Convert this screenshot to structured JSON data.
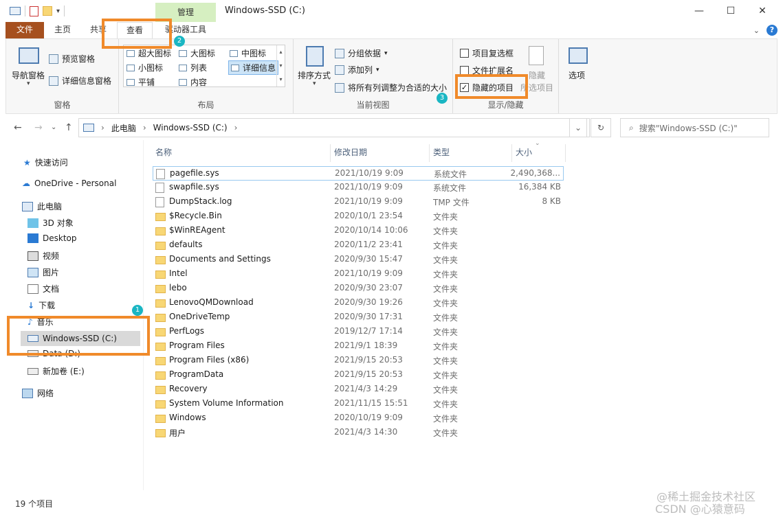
{
  "window": {
    "title": "Windows-SSD (C:)",
    "context_tab": "管理",
    "controls": {
      "minimize": "—",
      "maximize": "☐",
      "close": "✕"
    }
  },
  "ribbon_tabs": {
    "file": "文件",
    "home": "主页",
    "share": "共享",
    "view": "查看",
    "drive_tools": "驱动器工具",
    "collapse": "⌄",
    "help": "?"
  },
  "ribbon": {
    "panes": {
      "label": "窗格",
      "nav_pane": "导航窗格",
      "preview_pane": "预览窗格",
      "details_pane": "详细信息窗格"
    },
    "layout": {
      "label": "布局",
      "items": [
        "超大图标",
        "大图标",
        "中图标",
        "小图标",
        "列表",
        "详细信息",
        "平铺",
        "内容"
      ],
      "selected": "详细信息"
    },
    "current_view": {
      "label": "当前视图",
      "sort_by": "排序方式",
      "group_by": "分组依据",
      "add_columns": "添加列",
      "fit_columns": "将所有列调整为合适的大小"
    },
    "show_hide": {
      "label": "显示/隐藏",
      "item_checkboxes": {
        "label": "项目复选框",
        "checked": false
      },
      "file_extensions": {
        "label": "文件扩展名",
        "checked": false
      },
      "hidden_items": {
        "label": "隐藏的项目",
        "checked": true
      },
      "hide_selected": "隐藏",
      "hide_selected_2": "所选项目"
    },
    "options": "选项"
  },
  "badges": {
    "one": "1",
    "two": "2",
    "three": "3"
  },
  "nav": {
    "back": "←",
    "forward": "→",
    "recent": "⌄",
    "up": "↑",
    "breadcrumb": [
      "此电脑",
      "Windows-SSD (C:)"
    ],
    "search_placeholder": "搜索\"Windows-SSD (C:)\""
  },
  "sidebar": {
    "quick_access": "快速访问",
    "onedrive": "OneDrive - Personal",
    "this_pc": "此电脑",
    "items": [
      "3D 对象",
      "Desktop",
      "视频",
      "图片",
      "文档",
      "下载",
      "音乐",
      "Windows-SSD (C:)",
      "Data (D:)",
      "新加卷 (E:)"
    ],
    "network": "网络"
  },
  "columns": {
    "name": "名称",
    "date": "修改日期",
    "type": "类型",
    "size": "大小"
  },
  "files": [
    {
      "name": "pagefile.sys",
      "date": "2021/10/19 9:09",
      "type": "系统文件",
      "size": "2,490,368...",
      "kind": "file"
    },
    {
      "name": "swapfile.sys",
      "date": "2021/10/19 9:09",
      "type": "系统文件",
      "size": "16,384 KB",
      "kind": "file"
    },
    {
      "name": "DumpStack.log",
      "date": "2021/10/19 9:09",
      "type": "TMP 文件",
      "size": "8 KB",
      "kind": "file"
    },
    {
      "name": "$Recycle.Bin",
      "date": "2020/10/1 23:54",
      "type": "文件夹",
      "size": "",
      "kind": "folder"
    },
    {
      "name": "$WinREAgent",
      "date": "2020/10/14 10:06",
      "type": "文件夹",
      "size": "",
      "kind": "folder"
    },
    {
      "name": "defaults",
      "date": "2020/11/2 23:41",
      "type": "文件夹",
      "size": "",
      "kind": "folder"
    },
    {
      "name": "Documents and Settings",
      "date": "2020/9/30 15:47",
      "type": "文件夹",
      "size": "",
      "kind": "folder"
    },
    {
      "name": "Intel",
      "date": "2021/10/19 9:09",
      "type": "文件夹",
      "size": "",
      "kind": "folder"
    },
    {
      "name": "lebo",
      "date": "2020/9/30 23:07",
      "type": "文件夹",
      "size": "",
      "kind": "folder"
    },
    {
      "name": "LenovoQMDownload",
      "date": "2020/9/30 19:26",
      "type": "文件夹",
      "size": "",
      "kind": "folder"
    },
    {
      "name": "OneDriveTemp",
      "date": "2020/9/30 17:31",
      "type": "文件夹",
      "size": "",
      "kind": "folder"
    },
    {
      "name": "PerfLogs",
      "date": "2019/12/7 17:14",
      "type": "文件夹",
      "size": "",
      "kind": "folder"
    },
    {
      "name": "Program Files",
      "date": "2021/9/1 18:39",
      "type": "文件夹",
      "size": "",
      "kind": "folder"
    },
    {
      "name": "Program Files (x86)",
      "date": "2021/9/15 20:53",
      "type": "文件夹",
      "size": "",
      "kind": "folder"
    },
    {
      "name": "ProgramData",
      "date": "2021/9/15 20:53",
      "type": "文件夹",
      "size": "",
      "kind": "folder"
    },
    {
      "name": "Recovery",
      "date": "2021/4/3 14:29",
      "type": "文件夹",
      "size": "",
      "kind": "folder"
    },
    {
      "name": "System Volume Information",
      "date": "2021/11/15 15:51",
      "type": "文件夹",
      "size": "",
      "kind": "folder"
    },
    {
      "name": "Windows",
      "date": "2020/10/19 9:09",
      "type": "文件夹",
      "size": "",
      "kind": "folder"
    },
    {
      "name": "用户",
      "date": "2021/4/3 14:30",
      "type": "文件夹",
      "size": "",
      "kind": "folder"
    }
  ],
  "status": {
    "count": "19 个项目"
  },
  "watermarks": {
    "line1": "@稀土掘金技术社区",
    "line2": "CSDN @心猿意码"
  },
  "colors": {
    "file_tab": "#a6501f",
    "manage_tab": "#d6efc1",
    "highlight": "#f08a2a",
    "badge": "#1ab6c3",
    "selected": "#cce4f7"
  }
}
